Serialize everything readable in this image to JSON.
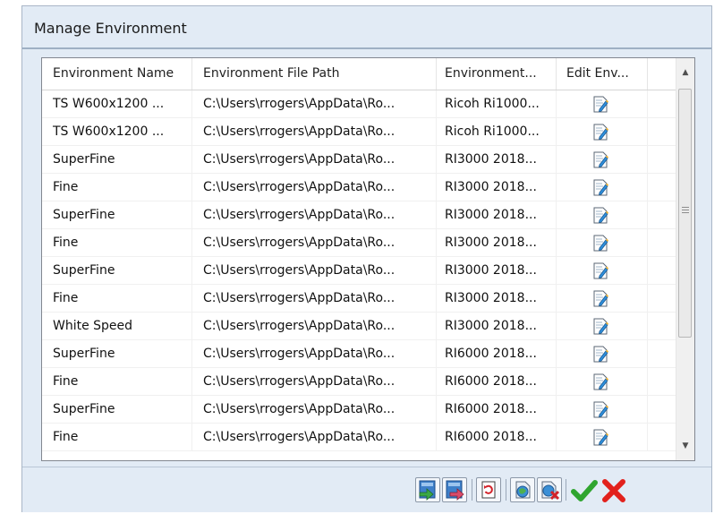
{
  "dialog": {
    "title": "Manage Environment"
  },
  "columns": [
    "Environment Name",
    "Environment File Path",
    "Environment...",
    "Edit Env..."
  ],
  "rows": [
    {
      "name": "TS W600x1200 ...",
      "path": "C:\\Users\\rrogers\\AppData\\Ro...",
      "env": "Ricoh Ri1000..."
    },
    {
      "name": "TS W600x1200 ...",
      "path": "C:\\Users\\rrogers\\AppData\\Ro...",
      "env": "Ricoh Ri1000..."
    },
    {
      "name": "SuperFine",
      "path": "C:\\Users\\rrogers\\AppData\\Ro...",
      "env": "RI3000 2018..."
    },
    {
      "name": "Fine",
      "path": "C:\\Users\\rrogers\\AppData\\Ro...",
      "env": "RI3000 2018..."
    },
    {
      "name": "SuperFine",
      "path": "C:\\Users\\rrogers\\AppData\\Ro...",
      "env": "RI3000 2018..."
    },
    {
      "name": "Fine",
      "path": "C:\\Users\\rrogers\\AppData\\Ro...",
      "env": "RI3000 2018..."
    },
    {
      "name": "SuperFine",
      "path": "C:\\Users\\rrogers\\AppData\\Ro...",
      "env": "RI3000 2018..."
    },
    {
      "name": "Fine",
      "path": "C:\\Users\\rrogers\\AppData\\Ro...",
      "env": "RI3000 2018..."
    },
    {
      "name": "White Speed",
      "path": "C:\\Users\\rrogers\\AppData\\Ro...",
      "env": "RI3000 2018..."
    },
    {
      "name": "SuperFine",
      "path": "C:\\Users\\rrogers\\AppData\\Ro...",
      "env": "RI6000 2018..."
    },
    {
      "name": "Fine",
      "path": "C:\\Users\\rrogers\\AppData\\Ro...",
      "env": "RI6000 2018..."
    },
    {
      "name": "SuperFine",
      "path": "C:\\Users\\rrogers\\AppData\\Ro...",
      "env": "RI6000 2018..."
    },
    {
      "name": "Fine",
      "path": "C:\\Users\\rrogers\\AppData\\Ro...",
      "env": "RI6000 2018..."
    }
  ],
  "icons": {
    "edit": "edit-document-icon",
    "toolbar": [
      "import-environment-icon",
      "export-environment-icon",
      "refresh-environment-icon",
      "add-environment-icon",
      "delete-environment-icon",
      "ok-check-icon",
      "cancel-x-icon"
    ]
  },
  "colors": {
    "titlebar_bg": "#e2ebf5",
    "ok_green": "#2fa52f",
    "cancel_red": "#e2211c"
  }
}
